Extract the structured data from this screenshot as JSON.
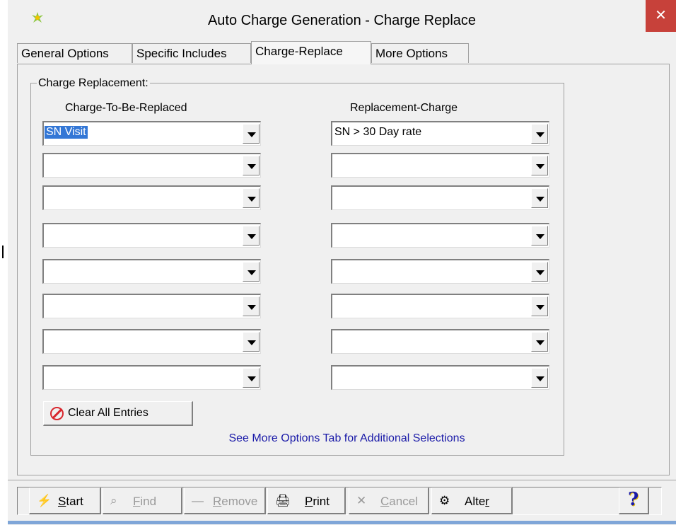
{
  "window": {
    "title": "Auto Charge Generation - Charge Replace",
    "close_label": "✕"
  },
  "tabs": [
    {
      "label": "General Options"
    },
    {
      "label": "Specific Includes"
    },
    {
      "label": "Charge-Replace",
      "active": true
    },
    {
      "label": "More Options"
    }
  ],
  "group": {
    "legend": "Charge Replacement:",
    "col_left": "Charge-To-Be-Replaced",
    "col_right": "Replacement-Charge",
    "rows": [
      {
        "left": "SN Visit",
        "right": "SN > 30 Day rate"
      },
      {
        "left": "",
        "right": ""
      },
      {
        "left": "",
        "right": ""
      },
      {
        "left": "",
        "right": ""
      },
      {
        "left": "",
        "right": ""
      },
      {
        "left": "",
        "right": ""
      },
      {
        "left": "",
        "right": ""
      },
      {
        "left": "",
        "right": ""
      }
    ],
    "clear_button": "Clear All Entries",
    "note": "See More Options Tab for Additional Selections"
  },
  "toolbar": {
    "start": {
      "pre": "",
      "u": "S",
      "post": "tart",
      "icon": "lightning-icon"
    },
    "find": {
      "pre": "",
      "u": "F",
      "post": "ind",
      "icon": "binoculars-icon"
    },
    "remove": {
      "pre": "",
      "u": "R",
      "post": "emove",
      "icon": "minus-icon"
    },
    "print": {
      "pre": "",
      "u": "P",
      "post": "rint",
      "icon": "printer-icon"
    },
    "cancel": {
      "pre": "",
      "u": "C",
      "post": "ancel",
      "icon": "x-icon"
    },
    "alter": {
      "pre": "Alte",
      "u": "r",
      "post": "",
      "icon": "alter-icon"
    },
    "help": "?"
  },
  "colors": {
    "close_bg": "#c7413a",
    "selection": "#3377d6",
    "note_text": "#1a1aa8"
  }
}
